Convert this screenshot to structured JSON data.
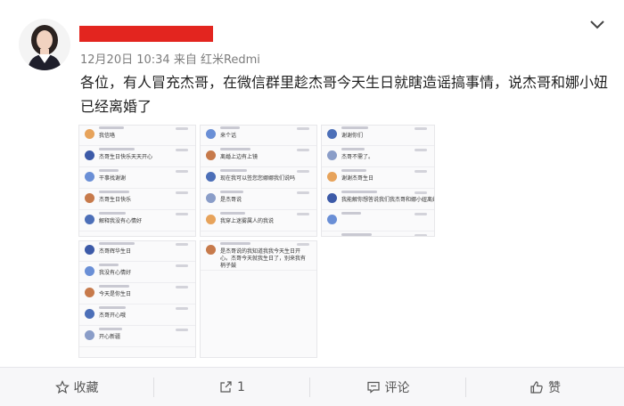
{
  "post": {
    "meta": "12月20日 10:34 来自 红米Redmi",
    "text": "各位，有人冒充杰哥，在微信群里趁杰哥今天生日就瞎造谣搞事情，说杰哥和娜小妞已经离婚了"
  },
  "screenshots": [
    {
      "name": "panel-a",
      "messages": [
        "我信咯",
        "杰哥生日快乐天天开心",
        "干事找谢谢",
        "杰哥生日快乐",
        "解释我没有心情好"
      ]
    },
    {
      "name": "panel-b",
      "messages": [
        "杰哥辉华生日",
        "我没有心情好",
        "今天是你生日",
        "杰哥开心哦",
        "开心新疆"
      ]
    },
    {
      "name": "panel-c",
      "messages": [
        "来个话",
        "离婚上边有上镜",
        "现在我可以签您您娜娜我们说吗",
        "是杰哥说",
        "我穿上迷雾属人的我说"
      ]
    },
    {
      "name": "panel-d",
      "messages": [
        "是杰哥说的我知道我我今天生日开心。杰哥今天就我生日了，别来我有梢子鼓"
      ]
    },
    {
      "name": "panel-e",
      "messages": [
        "谢谢你们",
        "杰哥不需了。",
        "谢谢杰哥生日",
        "我能解你想答说我们我杰哥和娜小妞离婚",
        "",
        "是杰说不行"
      ]
    }
  ],
  "actions": {
    "favorite": {
      "icon": "star-outline-icon",
      "label": "收藏"
    },
    "share": {
      "icon": "share-arrow-icon",
      "label": "1"
    },
    "comment": {
      "icon": "comment-bubble-icon",
      "label": "评论"
    },
    "like": {
      "icon": "thumbs-up-icon",
      "label": "赞"
    }
  },
  "colors": {
    "redaction": "#e3251f",
    "text": "#222222",
    "meta": "#7d7d7d",
    "heart": "#e05a8a",
    "diamond": "#3a8be0"
  }
}
